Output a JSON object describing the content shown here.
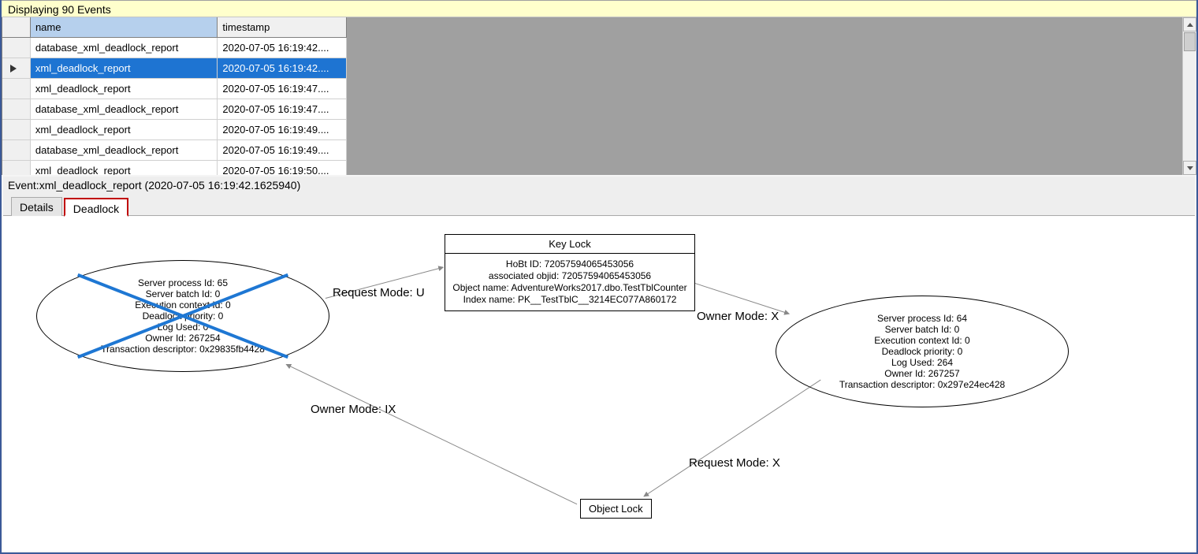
{
  "banner": {
    "text": "Displaying 90 Events"
  },
  "grid": {
    "headers": {
      "name": "name",
      "timestamp": "timestamp"
    },
    "rows": [
      {
        "name": "database_xml_deadlock_report",
        "timestamp": "2020-07-05 16:19:42....",
        "selected": false
      },
      {
        "name": "xml_deadlock_report",
        "timestamp": "2020-07-05 16:19:42....",
        "selected": true
      },
      {
        "name": "xml_deadlock_report",
        "timestamp": "2020-07-05 16:19:47....",
        "selected": false
      },
      {
        "name": "database_xml_deadlock_report",
        "timestamp": "2020-07-05 16:19:47....",
        "selected": false
      },
      {
        "name": "xml_deadlock_report",
        "timestamp": "2020-07-05 16:19:49....",
        "selected": false
      },
      {
        "name": "database_xml_deadlock_report",
        "timestamp": "2020-07-05 16:19:49....",
        "selected": false
      },
      {
        "name": "xml_deadlock_report",
        "timestamp": "2020-07-05 16:19:50....",
        "selected": false
      }
    ]
  },
  "event": {
    "title": "Event:xml_deadlock_report (2020-07-05 16:19:42.1625940)"
  },
  "tabs": {
    "details": "Details",
    "deadlock": "Deadlock"
  },
  "graph": {
    "victim": {
      "lines": [
        "Server process Id: 65",
        "Server batch Id: 0",
        "Execution context Id: 0",
        "Deadlock priority: 0",
        "Log Used: 0",
        "Owner Id: 267254",
        "Transaction descriptor: 0x29835fb4428"
      ]
    },
    "winner": {
      "lines": [
        "Server process Id: 64",
        "Server batch Id: 0",
        "Execution context Id: 0",
        "Deadlock priority: 0",
        "Log Used: 264",
        "Owner Id: 267257",
        "Transaction descriptor: 0x297e24ec428"
      ]
    },
    "keylock": {
      "title": "Key Lock",
      "lines": [
        "HoBt ID: 72057594065453056",
        "associated objid: 72057594065453056",
        "Object name: AdventureWorks2017.dbo.TestTblCounter",
        "Index name: PK__TestTblC__3214EC077A860172"
      ]
    },
    "objectlock": {
      "label": "Object Lock"
    },
    "edges": {
      "req_u": "Request Mode: U",
      "own_x": "Owner Mode: X",
      "own_ix": "Owner Mode: IX",
      "req_x": "Request Mode: X"
    }
  }
}
